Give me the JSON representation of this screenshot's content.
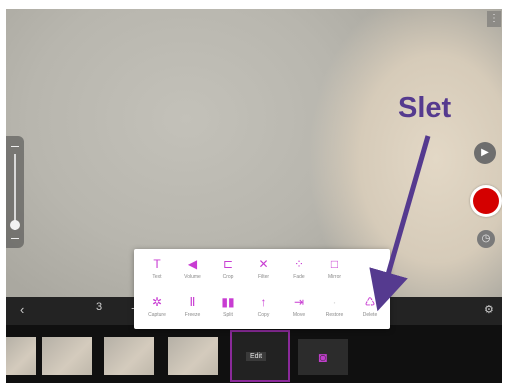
{
  "top_right_button": {
    "icon": "more-icon",
    "glyph": "⋮"
  },
  "side_controls": {
    "play": {
      "icon": "play-icon",
      "glyph": "▶"
    },
    "record": {
      "icon": "record-icon",
      "color": "#d40000"
    },
    "timer": {
      "icon": "timer-icon",
      "glyph": "◷"
    }
  },
  "timeline_bar": {
    "back": {
      "icon": "chevron-left-icon",
      "glyph": "‹"
    },
    "clip_count": "3",
    "add": {
      "icon": "plus-icon",
      "glyph": "+"
    },
    "settings": {
      "icon": "gear-icon",
      "glyph": "⚙"
    }
  },
  "clips": {
    "selected_label": "Edit",
    "camera": {
      "icon": "camera-icon",
      "glyph": "◙"
    }
  },
  "edit_menu": {
    "items": [
      {
        "name": "text",
        "glyph": "T",
        "label": "Text",
        "enabled": true
      },
      {
        "name": "volume",
        "glyph": "◀",
        "label": "Volume",
        "enabled": true
      },
      {
        "name": "crop",
        "glyph": "⊏",
        "label": "Crop",
        "enabled": true
      },
      {
        "name": "filter",
        "glyph": "✕",
        "label": "Filter",
        "enabled": true
      },
      {
        "name": "fade",
        "glyph": "⁘",
        "label": "Fade",
        "enabled": true
      },
      {
        "name": "mirror",
        "glyph": "□",
        "label": "Mirror",
        "enabled": true
      },
      {
        "name": "capture",
        "glyph": "✲",
        "label": "Capture",
        "enabled": true
      },
      {
        "name": "freeze",
        "glyph": "Ⅱ",
        "label": "Freeze",
        "enabled": true
      },
      {
        "name": "split",
        "glyph": "▮▮",
        "label": "Split",
        "enabled": true
      },
      {
        "name": "copy",
        "glyph": "↑",
        "label": "Copy",
        "enabled": true
      },
      {
        "name": "move",
        "glyph": "⇥",
        "label": "Move",
        "enabled": true
      },
      {
        "name": "restore",
        "glyph": "·",
        "label": "Restore",
        "enabled": false
      },
      {
        "name": "delete",
        "glyph": "♺",
        "label": "Delete",
        "enabled": true
      }
    ]
  },
  "annotation": {
    "text": "Slet",
    "color": "#553a8f"
  }
}
